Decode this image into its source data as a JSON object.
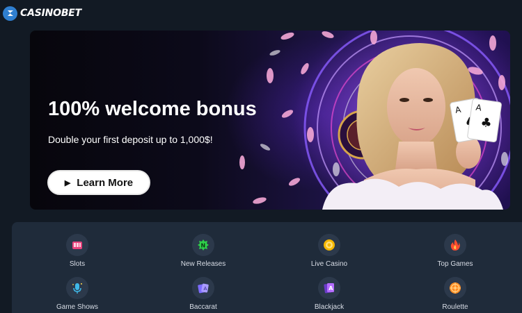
{
  "brand": {
    "name": "CASINOBET"
  },
  "banner": {
    "title": "100% welcome bonus",
    "subtitle": "Double your first deposit up to 1,000$!",
    "cta_label": "Learn More"
  },
  "categories": [
    {
      "label": "Slots",
      "icon": "slots-icon"
    },
    {
      "label": "New Releases",
      "icon": "new-badge-icon"
    },
    {
      "label": "Live Casino",
      "icon": "chip-icon"
    },
    {
      "label": "Top Games",
      "icon": "flame-icon"
    },
    {
      "label": "Game Shows",
      "icon": "microphone-icon"
    },
    {
      "label": "Baccarat",
      "icon": "cards-icon"
    },
    {
      "label": "Blackjack",
      "icon": "ace-card-icon"
    },
    {
      "label": "Roulette",
      "icon": "roulette-icon"
    }
  ],
  "colors": {
    "background": "#121a24",
    "panel": "#1f2b3a",
    "brand_blue": "#2f7fd0",
    "accent_purple": "#7a3cff"
  }
}
